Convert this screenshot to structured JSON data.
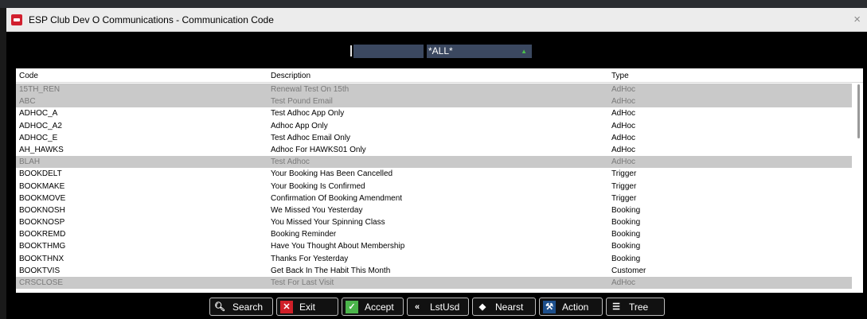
{
  "window": {
    "title": "ESP Club Dev O Communications - Communication Code",
    "close_glyph": "×"
  },
  "filter": {
    "left_value": "",
    "select_value": "*ALL*",
    "dropdown_glyph": "▲"
  },
  "grid": {
    "columns": {
      "code": "Code",
      "description": "Description",
      "type": "Type"
    },
    "rows": [
      {
        "code": "15TH_REN",
        "description": "Renewal Test On 15th",
        "type": "AdHoc",
        "dim": true
      },
      {
        "code": "ABC",
        "description": "Test Pound Email",
        "type": "AdHoc",
        "dim": true
      },
      {
        "code": "ADHOC_A",
        "description": "Test Adhoc App Only",
        "type": "AdHoc",
        "dim": false
      },
      {
        "code": "ADHOC_A2",
        "description": "Adhoc App Only",
        "type": "AdHoc",
        "dim": false
      },
      {
        "code": "ADHOC_E",
        "description": "Test Adhoc Email Only",
        "type": "AdHoc",
        "dim": false
      },
      {
        "code": "AH_HAWKS",
        "description": "Adhoc For HAWKS01 Only",
        "type": "AdHoc",
        "dim": false
      },
      {
        "code": "BLAH",
        "description": "Test Adhoc",
        "type": "AdHoc",
        "dim": true
      },
      {
        "code": "BOOKDELT",
        "description": "Your Booking Has Been Cancelled",
        "type": "Trigger",
        "dim": false
      },
      {
        "code": "BOOKMAKE",
        "description": "Your Booking Is Confirmed",
        "type": "Trigger",
        "dim": false
      },
      {
        "code": "BOOKMOVE",
        "description": "Confirmation Of Booking Amendment",
        "type": "Trigger",
        "dim": false
      },
      {
        "code": "BOOKNOSH",
        "description": "We Missed You Yesterday",
        "type": "Booking",
        "dim": false
      },
      {
        "code": "BOOKNOSP",
        "description": "You Missed Your Spinning Class",
        "type": "Booking",
        "dim": false
      },
      {
        "code": "BOOKREMD",
        "description": "Booking Reminder",
        "type": "Booking",
        "dim": false
      },
      {
        "code": "BOOKTHMG",
        "description": "Have You Thought About Membership",
        "type": "Booking",
        "dim": false
      },
      {
        "code": "BOOKTHNX",
        "description": "Thanks For Yesterday",
        "type": "Booking",
        "dim": false
      },
      {
        "code": "BOOKTVIS",
        "description": "Get Back In The Habit This Month",
        "type": "Customer",
        "dim": false
      },
      {
        "code": "CRSCLOSE",
        "description": "Test For Last Visit",
        "type": "AdHoc",
        "dim": true
      }
    ]
  },
  "buttons": {
    "search": {
      "label": "Search",
      "icon": "search-icon"
    },
    "exit": {
      "label": "Exit",
      "icon": "exit-icon"
    },
    "accept": {
      "label": "Accept",
      "icon": "accept-icon"
    },
    "lstusd": {
      "label": "LstUsd",
      "icon": "last-used-icon"
    },
    "nearst": {
      "label": "Nearst",
      "icon": "nearest-icon"
    },
    "action": {
      "label": "Action",
      "icon": "action-icon"
    },
    "tree": {
      "label": "Tree",
      "icon": "tree-icon"
    }
  },
  "colors": {
    "dim_row_bg": "#c9c9c9",
    "filter_field_bg": "#3b4860",
    "exit_red": "#d01f28",
    "accept_green": "#4bb54b"
  }
}
